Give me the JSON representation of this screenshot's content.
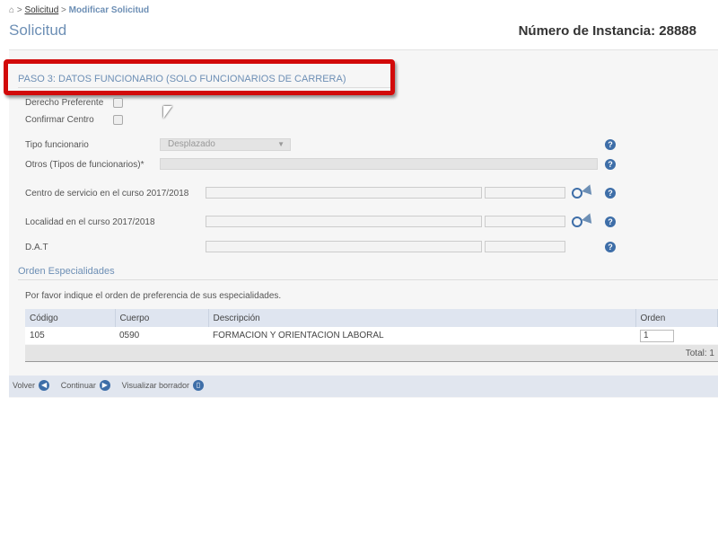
{
  "breadcrumb": {
    "home_icon": "home-icon",
    "items": [
      "Solicitud",
      "Modificar Solicitud"
    ]
  },
  "header": {
    "title": "Solicitud",
    "instance": "Número de Instancia: 28888"
  },
  "step": {
    "title": "PASO 3: DATOS FUNCIONARIO (SOLO FUNCIONARIOS DE CARRERA)"
  },
  "form": {
    "derecho": "Derecho Preferente",
    "confirmar": "Confirmar Centro",
    "tipo_label": "Tipo funcionario",
    "tipo_value": "Desplazado",
    "otros_label": "Otros (Tipos de funcionarios)*",
    "centro_label": "Centro de servicio en el curso 2017/2018",
    "localidad_label": "Localidad en el curso 2017/2018",
    "dat_label": "D.A.T",
    "help": "?"
  },
  "especialidades": {
    "title": "Orden Especialidades",
    "note": "Por favor indique el orden de preferencia de sus especialidades.",
    "headers": [
      "Código",
      "Cuerpo",
      "Descripción",
      "Orden"
    ],
    "rows": [
      {
        "codigo": "105",
        "cuerpo": "0590",
        "descripcion": "FORMACION Y ORIENTACION LABORAL",
        "orden": "1"
      }
    ],
    "total": "Total: 1"
  },
  "footer": {
    "volver": "Volver",
    "continuar": "Continuar",
    "borrador": "Visualizar borrador"
  }
}
